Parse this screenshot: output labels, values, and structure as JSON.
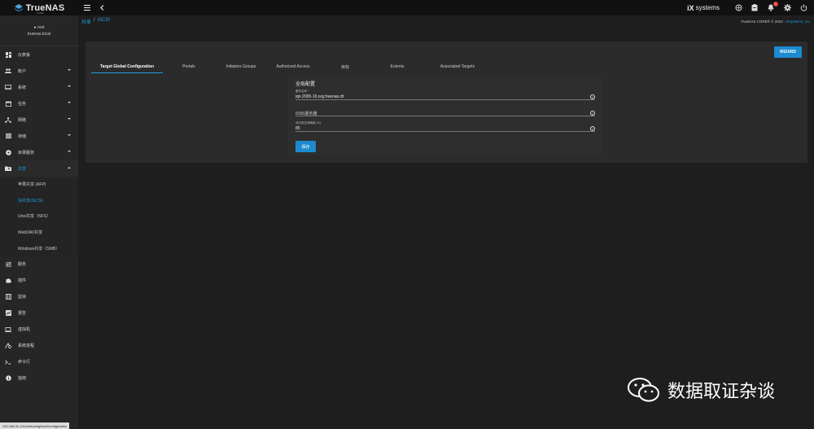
{
  "app": {
    "logo_text": "TrueNAS",
    "logo_sub": "CORE"
  },
  "topbar": {
    "brand_prefix": "iX",
    "brand_text": "systems",
    "alert_count": "1"
  },
  "user": {
    "name": "root",
    "host": "truenas.local"
  },
  "sidebar": {
    "items": [
      {
        "label": "仪表板"
      },
      {
        "label": "账户"
      },
      {
        "label": "系统"
      },
      {
        "label": "任务"
      },
      {
        "label": "网络"
      },
      {
        "label": "存储"
      },
      {
        "label": "目录服务"
      },
      {
        "label": "共享"
      }
    ],
    "share_sub": [
      {
        "label": "苹果共享 (AFP)"
      },
      {
        "label": "块共享(iSCSI)"
      },
      {
        "label": "Unix共享（NFS）"
      },
      {
        "label": "WebDAV共享"
      },
      {
        "label": "Windows共享（SMB）"
      }
    ],
    "items2": [
      {
        "label": "服务"
      },
      {
        "label": "插件"
      },
      {
        "label": "监狱"
      },
      {
        "label": "报告"
      },
      {
        "label": "虚拟机"
      },
      {
        "label": "系统进程"
      },
      {
        "label": "命令行"
      },
      {
        "label": "指南"
      }
    ]
  },
  "breadcrumb": {
    "root": "共享",
    "sep": "/",
    "current": "iSCSI"
  },
  "copyright": {
    "text": "TrueNAS CORE® © 2023 - ",
    "link": "iXsystems, Inc."
  },
  "wizard_label": "WIZARD",
  "tabs": [
    {
      "label": "Target Global Configuration"
    },
    {
      "label": "Portals"
    },
    {
      "label": "Initiators Groups"
    },
    {
      "label": "Authorized Access"
    },
    {
      "label": "目标"
    },
    {
      "label": "Extents"
    },
    {
      "label": "Associated Targets"
    }
  ],
  "form": {
    "title": "全局配置",
    "base_name_label": "基本名称 *",
    "base_name_value": "iqn.2005-10.org.freenas.ctl",
    "isns_placeholder": "iSNS服务器",
    "threshold_label": "池可用空间阈值 (%)",
    "threshold_value": "85",
    "save_label": "保存"
  },
  "status_url": "192.168.91.131/ui/sharing/iscsi/configuration",
  "watermark": {
    "text": "数据取证杂谈"
  },
  "colors": {
    "accent": "#1f9de0",
    "button": "#1c8bd0",
    "badge": "#e53935"
  }
}
